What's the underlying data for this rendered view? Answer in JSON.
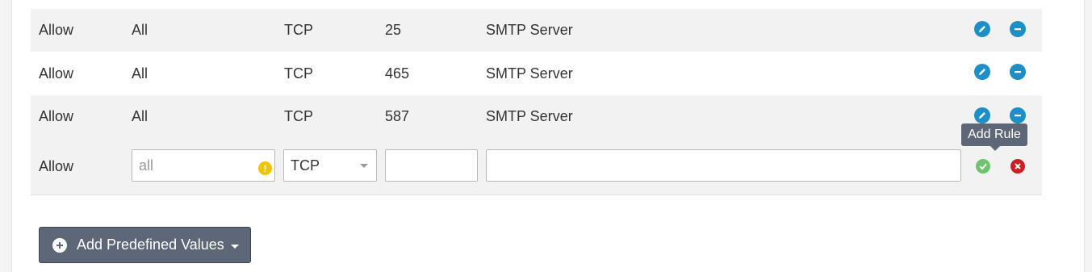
{
  "rules": [
    {
      "action": "Allow",
      "source": "All",
      "protocol": "TCP",
      "port": "25",
      "description": "SMTP Server"
    },
    {
      "action": "Allow",
      "source": "All",
      "protocol": "TCP",
      "port": "465",
      "description": "SMTP Server"
    },
    {
      "action": "Allow",
      "source": "All",
      "protocol": "TCP",
      "port": "587",
      "description": "SMTP Server"
    }
  ],
  "icons": {
    "edit": "pencil-icon",
    "delete": "minus-circle-icon",
    "confirm": "check-icon",
    "cancel": "x-icon",
    "warning": "exclamation-icon",
    "add": "plus-circle-icon"
  },
  "new_rule": {
    "action": "Allow",
    "source_value": "",
    "source_placeholder": "all",
    "protocol": "TCP",
    "port_value": "",
    "description_value": ""
  },
  "tooltip": {
    "add_rule": "Add Rule"
  },
  "buttons": {
    "add_predefined": "Add Predefined Values"
  },
  "colors": {
    "accent": "#1d8fc6",
    "confirm": "#6ec46e",
    "cancel": "#cc1f24",
    "button_bg": "#5d6778",
    "warning": "#f2c200"
  }
}
